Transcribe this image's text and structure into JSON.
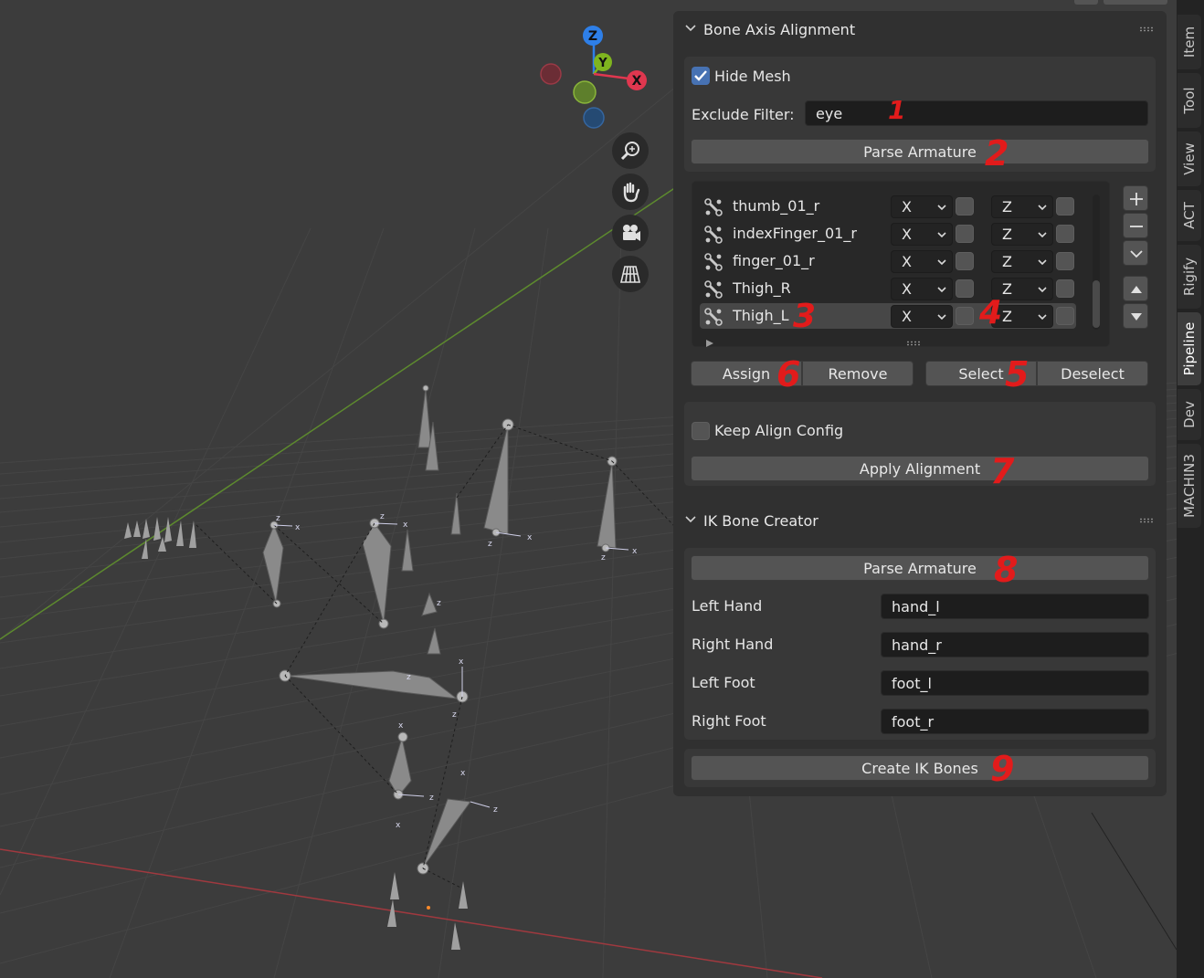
{
  "navigation_gizmo": {
    "z": "Z",
    "y": "Y",
    "x": "X"
  },
  "bone_axis_alignment": {
    "title": "Bone Axis Alignment",
    "hide_mesh_label": "Hide Mesh",
    "hide_mesh_checked": true,
    "exclude_filter_label": "Exclude Filter:",
    "exclude_filter_value": "eye",
    "parse_label": "Parse Armature",
    "bones": [
      {
        "name": "thumb_01_r",
        "axis1": "X",
        "axis2": "Z",
        "active": false
      },
      {
        "name": "indexFinger_01_r",
        "axis1": "X",
        "axis2": "Z",
        "active": false
      },
      {
        "name": "finger_01_r",
        "axis1": "X",
        "axis2": "Z",
        "active": false
      },
      {
        "name": "Thigh_R",
        "axis1": "X",
        "axis2": "Z",
        "active": false
      },
      {
        "name": "Thigh_L",
        "axis1": "X",
        "axis2": "Z",
        "active": true
      }
    ],
    "assign_label": "Assign",
    "remove_label": "Remove",
    "select_label": "Select",
    "deselect_label": "Deselect",
    "keep_align_label": "Keep Align Config",
    "keep_align_checked": false,
    "apply_label": "Apply Alignment"
  },
  "ik_bone_creator": {
    "title": "IK Bone Creator",
    "parse_label": "Parse Armature",
    "fields": [
      {
        "label": "Left Hand",
        "value": "hand_l"
      },
      {
        "label": "Right Hand",
        "value": "hand_r"
      },
      {
        "label": "Left Foot",
        "value": "foot_l"
      },
      {
        "label": "Right Foot",
        "value": "foot_r"
      }
    ],
    "create_label": "Create IK Bones"
  },
  "tabs": [
    "Item",
    "Tool",
    "View",
    "ACT",
    "Rigify",
    "Pipeline",
    "Dev",
    "MACHIN3"
  ],
  "active_tab": "Pipeline",
  "annotations": [
    "1",
    "2",
    "3",
    "4",
    "5",
    "6",
    "7",
    "8",
    "9"
  ],
  "colors": {
    "accent_blue": "#4772b3",
    "annotation_red": "#e21b1b",
    "axis_x": "#e0374f",
    "axis_y": "#7fb51f",
    "axis_z": "#2e7fe8"
  }
}
